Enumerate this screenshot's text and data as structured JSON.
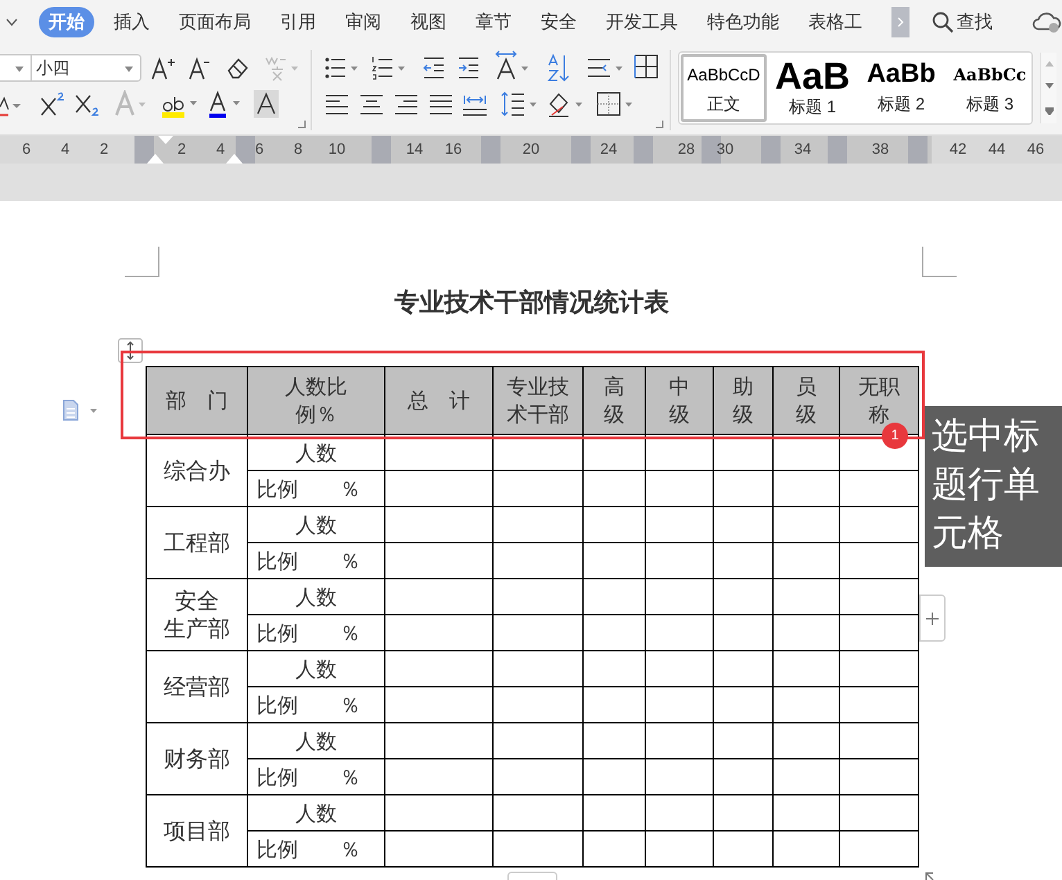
{
  "tabs": [
    {
      "label": "开始",
      "selected": true
    },
    {
      "label": "插入",
      "selected": false
    },
    {
      "label": "页面布局",
      "selected": false
    },
    {
      "label": "引用",
      "selected": false
    },
    {
      "label": "审阅",
      "selected": false
    },
    {
      "label": "视图",
      "selected": false
    },
    {
      "label": "章节",
      "selected": false
    },
    {
      "label": "安全",
      "selected": false
    },
    {
      "label": "开发工具",
      "selected": false
    },
    {
      "label": "特色功能",
      "selected": false
    },
    {
      "label": "表格工",
      "selected": false
    }
  ],
  "search": {
    "label": "查找"
  },
  "toolbar": {
    "font_size": "小四"
  },
  "styles": [
    {
      "kind": "body",
      "preview": "AaBbCcD",
      "label": "正文",
      "selected": true
    },
    {
      "kind": "h1",
      "preview": "AaB",
      "label": "标题 1",
      "selected": false
    },
    {
      "kind": "h2",
      "preview": "AaBb",
      "label": "标题 2",
      "selected": false
    },
    {
      "kind": "h3",
      "preview": "AaBbCc",
      "label": "标题 3",
      "selected": false
    }
  ],
  "ruler": {
    "ticks": [
      "6",
      "4",
      "2",
      "2",
      "4",
      "6",
      "8",
      "10",
      "14",
      "16",
      "20",
      "24",
      "28",
      "30",
      "34",
      "38",
      "42",
      "44",
      "46"
    ]
  },
  "document": {
    "title": "专业技术干部情况统计表",
    "table": {
      "header_selected": true,
      "columns": [
        "部　门",
        "人数比例％",
        "总　计",
        "专业技术干部",
        "高级",
        "中级",
        "助级",
        "员级",
        "无职称"
      ],
      "rows": [
        {
          "department": [
            "综合办"
          ],
          "count_label": "人数",
          "ratio_label": "比例　　％"
        },
        {
          "department": [
            "工程部"
          ],
          "count_label": "人数",
          "ratio_label": "比例　　％"
        },
        {
          "department": [
            "安全",
            "生产部"
          ],
          "count_label": "人数",
          "ratio_label": "比例　　％"
        },
        {
          "department": [
            "经营部"
          ],
          "count_label": "人数",
          "ratio_label": "比例　　％"
        },
        {
          "department": [
            "财务部"
          ],
          "count_label": "人数",
          "ratio_label": "比例　　％"
        },
        {
          "department": [
            "项目部"
          ],
          "count_label": "人数",
          "ratio_label": "比例　　％"
        }
      ]
    }
  },
  "callout": {
    "badge": "1",
    "text": "选中标题行单元格"
  }
}
